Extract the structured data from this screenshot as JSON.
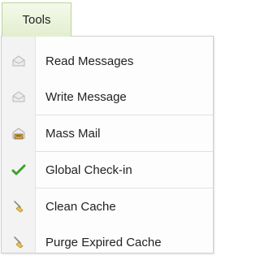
{
  "menu_tab": {
    "label": "Tools"
  },
  "menu": {
    "items": [
      {
        "label": "Read Messages",
        "icon": "envelope-open-icon"
      },
      {
        "label": "Write Message",
        "icon": "envelope-write-icon"
      },
      {
        "label": "Mass Mail",
        "icon": "mass-mail-icon"
      },
      {
        "label": "Global Check-in",
        "icon": "checkmark-icon"
      },
      {
        "label": "Clean Cache",
        "icon": "broom-icon"
      },
      {
        "label": "Purge Expired Cache",
        "icon": "broom-purge-icon"
      }
    ]
  },
  "colors": {
    "tab_border": "#bcd29a",
    "tab_background": "#e3eed0",
    "check": "#3fa02c"
  }
}
